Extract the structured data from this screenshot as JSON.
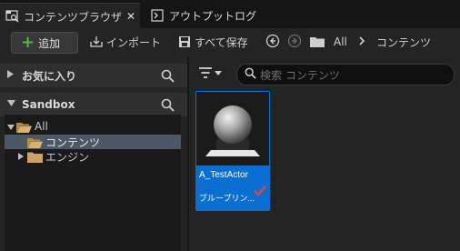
{
  "tabs": [
    {
      "label": "コンテンツブラウザ",
      "active": true,
      "icon": "content-browser-icon"
    },
    {
      "label": "アウトプットログ",
      "active": false,
      "icon": "output-log-icon"
    }
  ],
  "tab_close": "✕",
  "toolbar": {
    "add_label": "追加",
    "import_label": "インポート",
    "save_all_label": "すべて保存",
    "path": [
      "All",
      "コンテンツ"
    ]
  },
  "sidebar": {
    "favorites": {
      "label": "お気に入り",
      "expanded": false
    },
    "sandbox": {
      "label": "Sandbox",
      "expanded": true
    },
    "tree": [
      {
        "label": "All",
        "level": 0,
        "expanded": true,
        "selected": false
      },
      {
        "label": "コンテンツ",
        "level": 1,
        "expanded": false,
        "selected": true
      },
      {
        "label": "エンジン",
        "level": 1,
        "expanded": false,
        "selected": false,
        "has_children": true
      }
    ]
  },
  "search": {
    "placeholder": "検索 コンテンツ"
  },
  "assets": [
    {
      "name": "A_TestActor",
      "type": "ブループリン...",
      "checked": true
    }
  ],
  "colors": {
    "accent": "#0a6fd3",
    "add_green": "#46c03b",
    "selection": "#4c5866",
    "check": "#e0453c",
    "folder": "#c9a55f"
  }
}
